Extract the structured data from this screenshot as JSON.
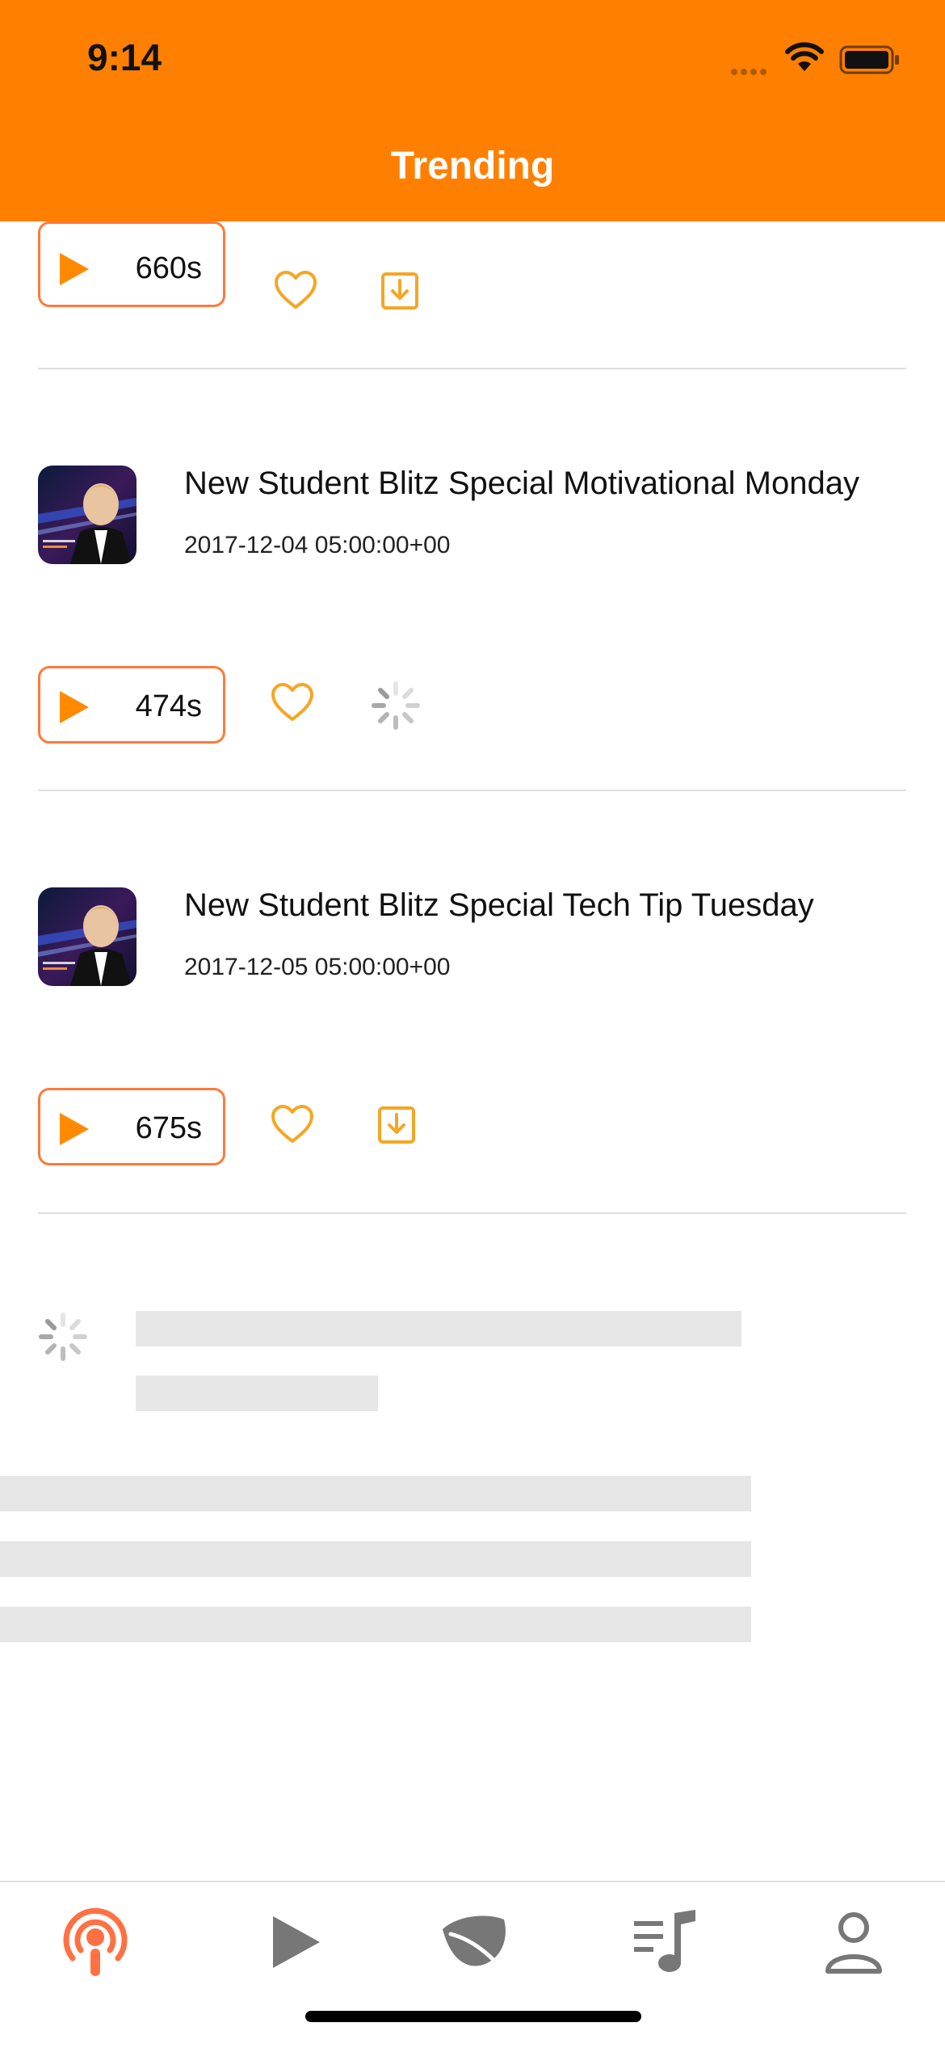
{
  "status_bar": {
    "time": "9:14"
  },
  "header": {
    "title": "Trending"
  },
  "episodes": [
    {
      "duration": "660s",
      "download_state": "download"
    },
    {
      "title": "New Student Blitz Special Motivational Monday",
      "date": "2017-12-04 05:00:00+00",
      "duration": "474s",
      "download_state": "loading"
    },
    {
      "title": "New Student Blitz Special Tech Tip Tuesday",
      "date": "2017-12-05 05:00:00+00",
      "duration": "675s",
      "download_state": "download"
    }
  ],
  "tabs": [
    {
      "name": "podcasts",
      "icon": "podcast-icon",
      "active": true
    },
    {
      "name": "player",
      "icon": "play-icon",
      "active": false
    },
    {
      "name": "explore",
      "icon": "leaf-icon",
      "active": false
    },
    {
      "name": "playlist",
      "icon": "playlist-music-icon",
      "active": false
    },
    {
      "name": "profile",
      "icon": "user-icon",
      "active": false
    }
  ],
  "colors": {
    "accent": "#ff8000",
    "button_border": "#ff7a3a",
    "icon_orange": "#f5a623",
    "tab_active": "#ff7043",
    "tab_inactive": "#777777"
  }
}
